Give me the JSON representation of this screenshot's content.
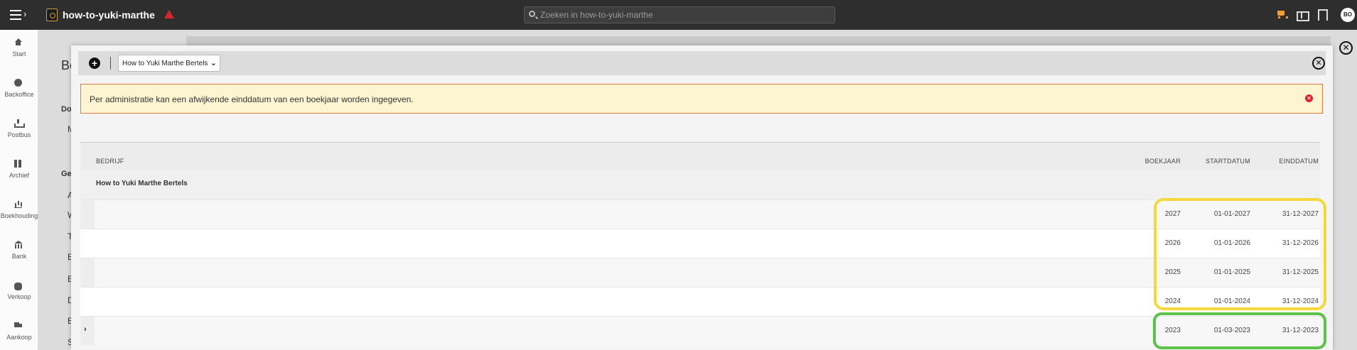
{
  "topbar": {
    "app_name": "how-to-yuki-marthe",
    "search_placeholder": "Zoeken in how-to-yuki-marthe",
    "avatar_initials": "BO",
    "colors": {
      "bar": "#2e2e2e",
      "warning": "#d9262c",
      "cart": "#f0a030"
    }
  },
  "sidebar": {
    "items": [
      {
        "label": "Start",
        "icon": "home-icon"
      },
      {
        "label": "Backoffice",
        "icon": "backoffice-icon"
      },
      {
        "label": "Postbus",
        "icon": "inbox-icon"
      },
      {
        "label": "Archief",
        "icon": "archive-icon"
      },
      {
        "label": "Boekhouding",
        "icon": "chart-icon"
      },
      {
        "label": "Bank",
        "icon": "bank-icon"
      },
      {
        "label": "Verkoop",
        "icon": "sale-icon"
      },
      {
        "label": "Aankoop",
        "icon": "truck-icon"
      }
    ]
  },
  "background": {
    "title_fragment": "Be",
    "section1": "Do",
    "item_m": "M",
    "section2": "Ge",
    "letters": [
      "A",
      "W",
      "T",
      "E",
      "B",
      "D",
      "B",
      "S"
    ]
  },
  "modal": {
    "company_select": "How to Yuki Marthe Bertels",
    "alert_text": "Per administratie kan een afwijkende einddatum van een boekjaar worden ingegeven.",
    "table": {
      "headers": {
        "company": "BEDRIJF",
        "fiscal_year": "BOEKJAAR",
        "start": "STARTDATUM",
        "end": "EINDDATUM"
      },
      "group": "How to Yuki Marthe Bertels",
      "rows": [
        {
          "year": "2027",
          "start": "01-01-2027",
          "end": "31-12-2027"
        },
        {
          "year": "2026",
          "start": "01-01-2026",
          "end": "31-12-2026"
        },
        {
          "year": "2025",
          "start": "01-01-2025",
          "end": "31-12-2025"
        },
        {
          "year": "2024",
          "start": "01-01-2024",
          "end": "31-12-2024"
        },
        {
          "year": "2023",
          "start": "01-03-2023",
          "end": "31-12-2023"
        }
      ]
    },
    "highlight_colors": {
      "yellow": "#f5d83a",
      "green": "#5cc24a"
    }
  }
}
